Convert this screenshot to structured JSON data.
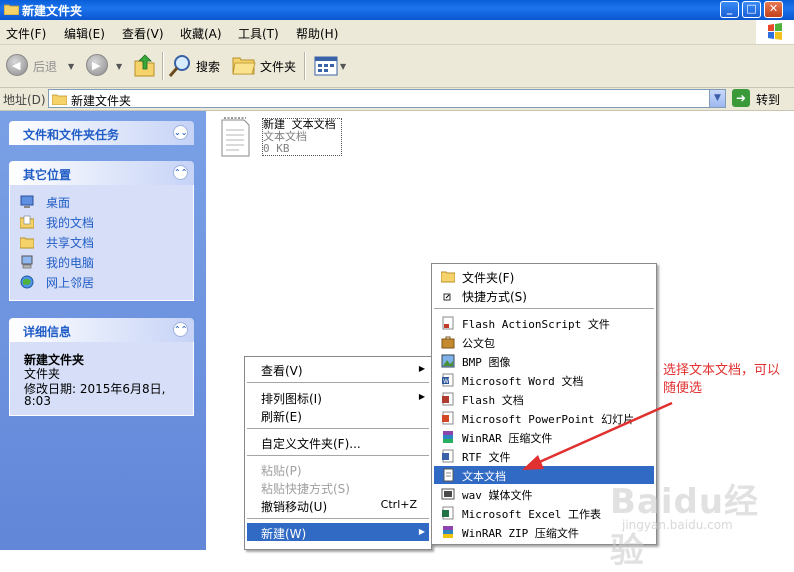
{
  "window": {
    "title": "新建文件夹"
  },
  "menubar": [
    "文件(F)",
    "编辑(E)",
    "查看(V)",
    "收藏(A)",
    "工具(T)",
    "帮助(H)"
  ],
  "toolbar": {
    "back": "后退",
    "search": "搜索",
    "folders": "文件夹"
  },
  "address": {
    "label": "地址(D)",
    "value": "新建文件夹",
    "go": "转到"
  },
  "taskpane": {
    "tasks": {
      "title": "文件和文件夹任务"
    },
    "places": {
      "title": "其它位置",
      "items": [
        "桌面",
        "我的文档",
        "共享文档",
        "我的电脑",
        "网上邻居"
      ]
    },
    "details": {
      "title": "详细信息",
      "name": "新建文件夹",
      "type": "文件夹",
      "modified_label": "修改日期: 2015年6月8日,",
      "modified_time": "8:03"
    }
  },
  "file": {
    "name": "新建 文本文档",
    "type": "文本文档",
    "size": "0 KB"
  },
  "context_menu": {
    "view": "查看(V)",
    "arrange": "排列图标(I)",
    "refresh": "刷新(E)",
    "customize": "自定义文件夹(F)...",
    "paste": "粘贴(P)",
    "paste_shortcut": "粘贴快捷方式(S)",
    "undo": "撤销移动(U)",
    "undo_shortcut": "Ctrl+Z",
    "new": "新建(W)"
  },
  "new_menu": {
    "folder": "文件夹(F)",
    "shortcut": "快捷方式(S)",
    "items": [
      "Flash ActionScript 文件",
      "公文包",
      "BMP 图像",
      "Microsoft Word 文档",
      "Flash 文档",
      "Microsoft PowerPoint 幻灯片",
      "WinRAR 压缩文件",
      "RTF 文件",
      "文本文档",
      "wav 媒体文件",
      "Microsoft Excel 工作表",
      "WinRAR ZIP 压缩文件"
    ]
  },
  "annotation": {
    "text": "选择文本文档，可以随便选"
  },
  "watermark": {
    "brand": "Baidu经验",
    "url": "jingyan.baidu.com"
  },
  "colors": {
    "title_blue": "#0a5fd8",
    "highlight": "#316ac5",
    "annotation_red": "#e03030",
    "pane_blue": "#6e94dd"
  }
}
